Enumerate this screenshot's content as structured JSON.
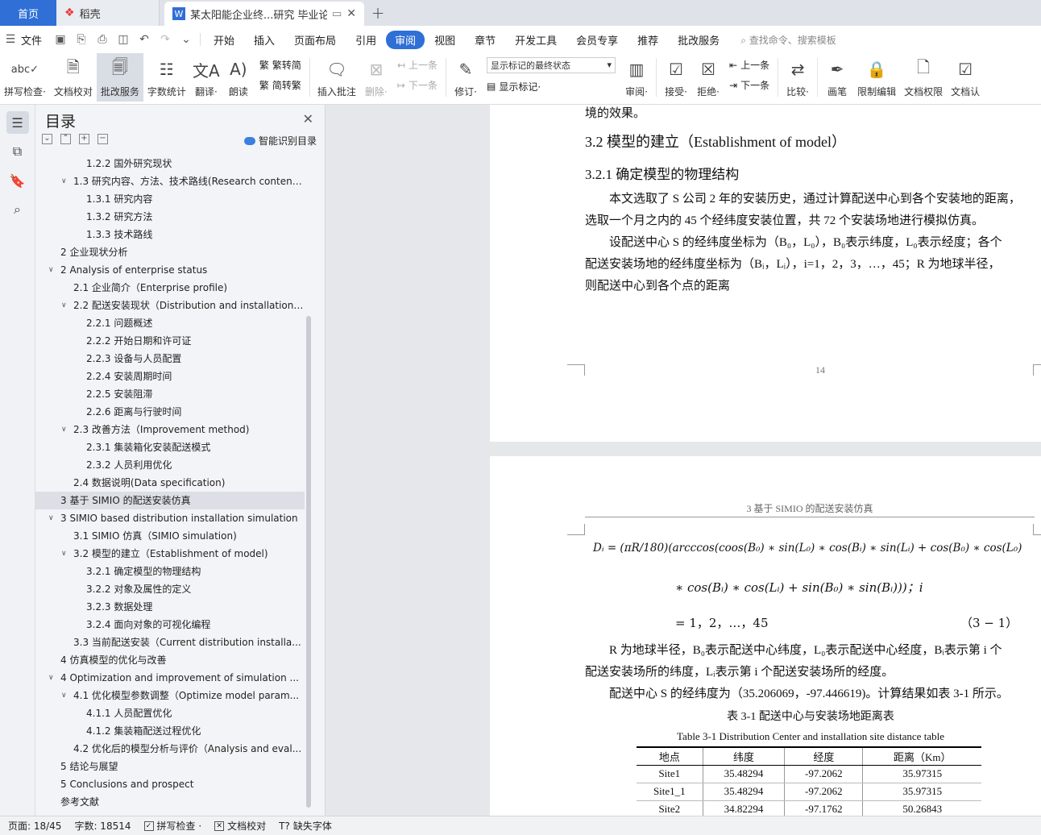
{
  "tabs": {
    "home": "首页",
    "daoke": "稻壳",
    "doc": "某太阳能企业终...研究 毕业论文"
  },
  "menu": {
    "file": "文件",
    "items": [
      "开始",
      "插入",
      "页面布局",
      "引用",
      "审阅",
      "视图",
      "章节",
      "开发工具",
      "会员专享",
      "推荐",
      "批改服务"
    ],
    "active_index": 4,
    "search": "查找命令、搜索模板"
  },
  "ribbon": {
    "spell": "拼写检查·",
    "doccheck": "文档校对",
    "correct": "批改服务",
    "wordcount": "字数统计",
    "translate": "翻译·",
    "read": "朗读",
    "trad": "繁转简",
    "simp": "简转繁",
    "insert_comment": "插入批注",
    "delete": "删除·",
    "prev": "上一条",
    "next": "下一条",
    "revise": "修订·",
    "mark_select": "显示标记的最终状态",
    "show_marks": "显示标记·",
    "review": "审阅·",
    "accept": "接受·",
    "reject": "拒绝·",
    "prev2": "上一条",
    "next2": "下一条",
    "compare": "比较·",
    "pen": "画笔",
    "restrict": "限制编辑",
    "perm": "文档权限",
    "more": "文档认"
  },
  "toc": {
    "title": "目录",
    "smart": "智能识别目录",
    "items": [
      {
        "t": "1.2.2  国外研究现状",
        "lv": 2,
        "c": ""
      },
      {
        "t": "1.3  研究内容、方法、技术路线(Research content...",
        "lv": 1,
        "c": "v"
      },
      {
        "t": "1.3.1  研究内容",
        "lv": 2,
        "c": ""
      },
      {
        "t": "1.3.2  研究方法",
        "lv": 2,
        "c": ""
      },
      {
        "t": "1.3.3  技术路线",
        "lv": 2,
        "c": ""
      },
      {
        "t": "2  企业现状分析",
        "lv": 0,
        "c": ""
      },
      {
        "t": "2 Analysis of enterprise status",
        "lv": 0,
        "c": "v"
      },
      {
        "t": "2.1  企业简介（Enterprise profile)",
        "lv": 1,
        "c": ""
      },
      {
        "t": "2.2  配送安装现状（Distribution and installation ...",
        "lv": 1,
        "c": "v"
      },
      {
        "t": "2.2.1  问题概述",
        "lv": 2,
        "c": ""
      },
      {
        "t": "2.2.2  开始日期和许可证",
        "lv": 2,
        "c": ""
      },
      {
        "t": "2.2.3  设备与人员配置",
        "lv": 2,
        "c": ""
      },
      {
        "t": "2.2.4  安装周期时间",
        "lv": 2,
        "c": ""
      },
      {
        "t": "2.2.5  安装阻滞",
        "lv": 2,
        "c": ""
      },
      {
        "t": "2.2.6  距离与行驶时间",
        "lv": 2,
        "c": ""
      },
      {
        "t": "2.3  改善方法（Improvement method)",
        "lv": 1,
        "c": "v"
      },
      {
        "t": "2.3.1  集装箱化安装配送模式",
        "lv": 2,
        "c": ""
      },
      {
        "t": "2.3.2  人员利用优化",
        "lv": 2,
        "c": ""
      },
      {
        "t": "2.4  数据说明(Data specification)",
        "lv": 1,
        "c": ""
      },
      {
        "t": "3  基于 SIMIO 的配送安装仿真",
        "lv": 0,
        "c": "",
        "sel": true
      },
      {
        "t": "3 SIMIO based distribution installation simulation",
        "lv": 0,
        "c": "v"
      },
      {
        "t": "3.1 SIMIO 仿真（SIMIO simulation)",
        "lv": 1,
        "c": ""
      },
      {
        "t": "3.2  模型的建立（Establishment of model)",
        "lv": 1,
        "c": "v"
      },
      {
        "t": "3.2.1  确定模型的物理结构",
        "lv": 2,
        "c": ""
      },
      {
        "t": "3.2.2  对象及属性的定义",
        "lv": 2,
        "c": ""
      },
      {
        "t": "3.2.3  数据处理",
        "lv": 2,
        "c": ""
      },
      {
        "t": "3.2.4  面向对象的可视化编程",
        "lv": 2,
        "c": ""
      },
      {
        "t": "3.3  当前配送安装（Current distribution installa...",
        "lv": 1,
        "c": ""
      },
      {
        "t": "4  仿真模型的优化与改善",
        "lv": 0,
        "c": ""
      },
      {
        "t": "4 Optimization and improvement of simulation ...",
        "lv": 0,
        "c": "v"
      },
      {
        "t": "4.1  优化模型参数调整（Optimize model param...",
        "lv": 1,
        "c": "v"
      },
      {
        "t": "4.1.1  人员配置优化",
        "lv": 2,
        "c": ""
      },
      {
        "t": "4.1.2  集装箱配送过程优化",
        "lv": 2,
        "c": ""
      },
      {
        "t": "4.2  优化后的模型分析与评价（Analysis and eval...",
        "lv": 1,
        "c": ""
      },
      {
        "t": "5  结论与展望",
        "lv": 0,
        "c": ""
      },
      {
        "t": "5 Conclusions and prospect",
        "lv": 0,
        "c": ""
      },
      {
        "t": "参考文献",
        "lv": 0,
        "c": ""
      }
    ]
  },
  "page1": {
    "line0": "境的效果。",
    "h2": "3.2  模型的建立（Establishment of model）",
    "h3": "3.2.1  确定模型的物理结构",
    "p1a": "　　本文选取了 S 公司 2 年的安装历史，通过计算配送中心到各个安装地的距离，",
    "p1b": "选取一个月之内的 45 个经纬度安装位置，共 72 个安装场地进行模拟仿真。",
    "p2a": "　　设配送中心 S 的经纬度坐标为（B₀，L₀），B₀表示纬度，L₀表示经度；各个",
    "p2b": "配送安装场地的经纬度坐标为（Bᵢ，Lᵢ），i=1，2，3，…，45；R 为地球半径，",
    "p2c": "则配送中心到各个点的距离",
    "pagenum": "14"
  },
  "page2": {
    "runhead": "3 基于 SIMIO 的配送安装仿真",
    "eq1": "Dᵢ = (πR/180)(arcccos(coos(B₀) ∗ sin(L₀) ∗ cos(Bᵢ) ∗ sin(Lᵢ) + cos(B₀) ∗ cos(L₀)",
    "eq2": "∗ cos(Bᵢ) ∗ cos(Lᵢ) + sin(B₀) ∗ sin(Bᵢ)))；i",
    "eq3": "= 1，2，…，45",
    "eqnum": "（3 − 1）",
    "p1a": "　　R 为地球半径，B₀表示配送中心纬度，L₀表示配送中心经度，Bᵢ表示第 i 个",
    "p1b": "配送安装场所的纬度，Lᵢ表示第 i 个配送安装场所的经度。",
    "p2": "　　配送中心 S 的经纬度为（35.206069，-97.446619)。计算结果如表 3-1 所示。",
    "cap_cn": "表 3-1  配送中心与安装场地距离表",
    "cap_en": "Table 3-1 Distribution Center and installation site distance table",
    "headers": [
      "地点",
      "纬度",
      "经度",
      "距离（Km）"
    ],
    "rows": [
      [
        "Site1",
        "35.48294",
        "-97.2062",
        "35.97315"
      ],
      [
        "Site1_1",
        "35.48294",
        "-97.2062",
        "35.97315"
      ],
      [
        "Site2",
        "34.82294",
        "-97.1762",
        "50.26843"
      ]
    ]
  },
  "status": {
    "page": "页面: 18/45",
    "words": "字数: 18514",
    "spell": "拼写检查 ·",
    "doccheck": "文档校对",
    "font": "缺失字体"
  }
}
